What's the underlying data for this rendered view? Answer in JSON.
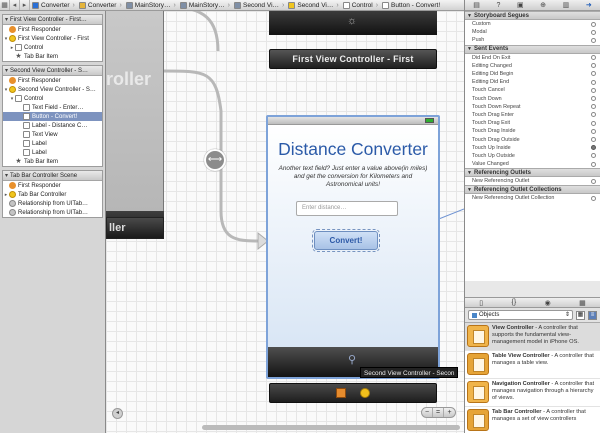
{
  "jumpbar": {
    "crumbs": [
      {
        "label": "Converter",
        "color": "#2a6fd6"
      },
      {
        "label": "Converter",
        "color": "#e5b43a"
      },
      {
        "label": "MainStory…",
        "color": "#7f8fa6"
      },
      {
        "label": "MainStory…",
        "color": "#7f8fa6"
      },
      {
        "label": "Second Vi…",
        "color": "#7f8fa6"
      },
      {
        "label": "Second Vi…",
        "color": "#f0c51e"
      },
      {
        "label": "Control",
        "color": "#ffffff"
      },
      {
        "label": "Button - Convert!",
        "color": "#ffffff"
      }
    ]
  },
  "outline": {
    "scene1": {
      "title": "First View Controller - First…",
      "rows": [
        "First Responder",
        "First View Controller - First",
        "Control",
        "Tab Bar Item"
      ]
    },
    "scene2": {
      "title": "Second View Controller - S…",
      "rows": [
        "First Responder",
        "Second View Controller - S…",
        "Control",
        "Text Field - Enter…",
        "Button - Convert!",
        "Label - Distance C…",
        "Text View",
        "Label",
        "Label",
        "Tab Bar Item"
      ]
    },
    "scene3": {
      "title": "Tab Bar Controller Scene",
      "rows": [
        "First Responder",
        "Tab Bar Controller",
        "Relationship from UITab…",
        "Relationship from UITab…"
      ]
    }
  },
  "canvas": {
    "ghost_text": "roller",
    "ghost_bar_text": "ller",
    "first_scene_label": "First View Controller - First",
    "phone": {
      "title": "Distance Converter",
      "description": "Another text field? Just enter a value above(in miles) and get the conversion for Kilometers and Astronomical units!",
      "input_placeholder": "Enter distance…",
      "button_label": "Convert!"
    },
    "tooltip": "Second View Controller - Secon"
  },
  "inspector": {
    "sections": {
      "segues": {
        "title": "Storyboard Segues",
        "items": [
          "Custom",
          "Modal",
          "Push"
        ]
      },
      "events": {
        "title": "Sent Events",
        "items": [
          "Did End On Exit",
          "Editing Changed",
          "Editing Did Begin",
          "Editing Did End",
          "Touch Cancel",
          "Touch Down",
          "Touch Down Repeat",
          "Touch Drag Enter",
          "Touch Drag Exit",
          "Touch Drag Inside",
          "Touch Drag Outside",
          "Touch Up Inside",
          "Touch Up Outside",
          "Value Changed"
        ]
      },
      "outlets": {
        "title": "Referencing Outlets",
        "items": [
          "New Referencing Outlet"
        ]
      },
      "collections": {
        "title": "Referencing Outlet Collections",
        "items": [
          "New Referencing Outlet Collection"
        ]
      }
    },
    "library": {
      "selector_label": "Objects",
      "items": [
        {
          "name": "View Controller",
          "desc": " - A controller that supports the fundamental view-management model in iPhone OS."
        },
        {
          "name": "Table View Controller",
          "desc": " - A controller that manages a table view."
        },
        {
          "name": "Navigation Controller",
          "desc": " - A controller that manages navigation through a hierarchy of views."
        },
        {
          "name": "Tab Bar Controller",
          "desc": " - A controller that manages a set of view controllers"
        }
      ]
    }
  }
}
